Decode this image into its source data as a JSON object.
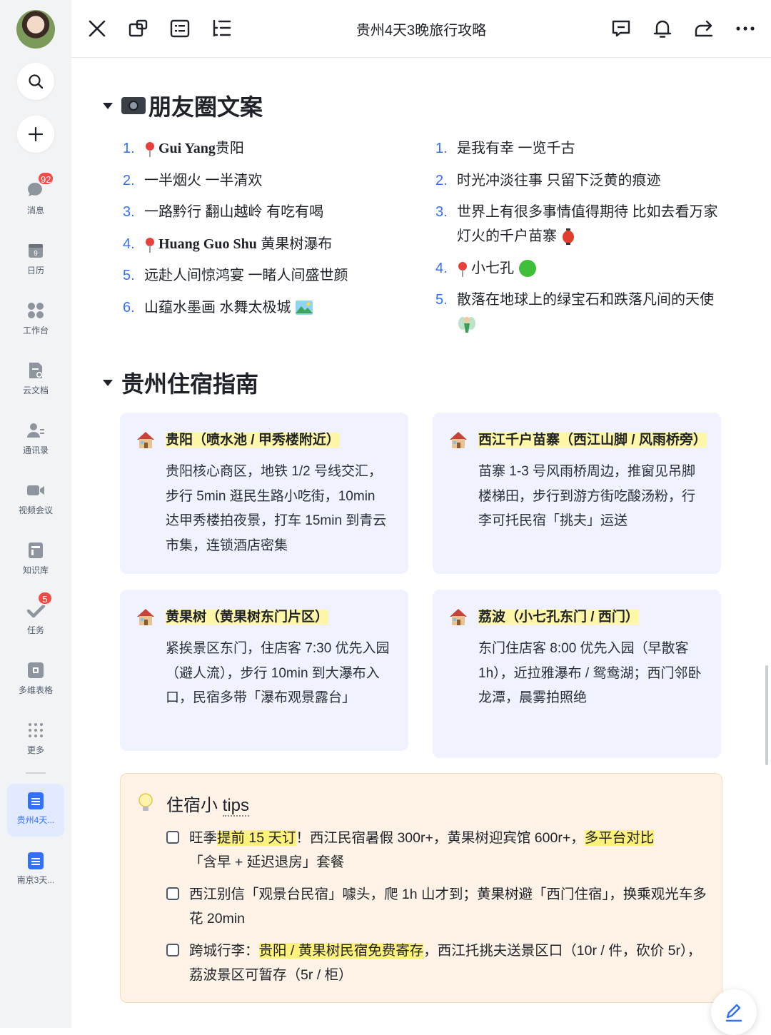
{
  "sidebar": {
    "nav": [
      {
        "label": "消息",
        "icon": "chat-bubble-icon",
        "badge": "92"
      },
      {
        "label": "日历",
        "icon": "calendar-icon",
        "date": "9"
      },
      {
        "label": "工作台",
        "icon": "apps-grid-icon"
      },
      {
        "label": "云文档",
        "icon": "cloud-doc-icon"
      },
      {
        "label": "通讯录",
        "icon": "contacts-icon"
      },
      {
        "label": "视频会议",
        "icon": "video-camera-icon"
      },
      {
        "label": "知识库",
        "icon": "knowledge-base-icon"
      },
      {
        "label": "任务",
        "icon": "task-check-icon",
        "badge": "5"
      },
      {
        "label": "多维表格",
        "icon": "base-table-icon"
      },
      {
        "label": "更多",
        "icon": "more-dots-grid-icon"
      }
    ],
    "open_docs": [
      {
        "label": "贵州4天...",
        "active": true
      },
      {
        "label": "南京3天...",
        "active": false
      }
    ]
  },
  "topbar": {
    "title": "贵州4天3晚旅行攻略"
  },
  "section1": {
    "heading": "朋友圈文案",
    "left_list": [
      {
        "num": "1.",
        "pin": true,
        "bold": "Gui Yang",
        "text": "贵阳"
      },
      {
        "num": "2.",
        "text": "一半烟火 一半清欢"
      },
      {
        "num": "3.",
        "text": "一路黔行 翻山越岭 有吃有喝"
      },
      {
        "num": "4.",
        "pin": true,
        "bold": "Huang Guo Shu",
        "text": " 黄果树瀑布"
      },
      {
        "num": "5.",
        "text": "远赴人间惊鸿宴 一睹人间盛世颜"
      },
      {
        "num": "6.",
        "text": "山蕴水墨画 水舞太极城"
      }
    ],
    "right_list": [
      {
        "num": "1.",
        "text": "是我有幸  一览千古"
      },
      {
        "num": "2.",
        "text": "时光冲淡往事  只留下泛黄的痕迹"
      },
      {
        "num": "3.",
        "text": "世界上有很多事情值得期待 比如去看万家灯火的千户苗寨"
      },
      {
        "num": "4.",
        "pin": true,
        "text": "小七孔"
      },
      {
        "num": "5.",
        "text": "散落在地球上的绿宝石和跌落凡间的天使"
      }
    ]
  },
  "section2": {
    "heading": "贵州住宿指南",
    "cards": [
      {
        "title": "贵阳（喷水池 / 甲秀楼附近）",
        "body": "贵阳核心商区，地铁 1/2 号线交汇，步行 5min 逛民生路小吃街，10min 达甲秀楼拍夜景，打车 15min 到青云市集，连锁酒店密集"
      },
      {
        "title": "西江千户苗寨（西江山脚 / 风雨桥旁）",
        "body": "苗寨 1-3 号风雨桥周边，推窗见吊脚楼梯田，步行到游方街吃酸汤粉，行李可托民宿「挑夫」运送"
      },
      {
        "title": "黄果树（黄果树东门片区）",
        "body": "紧挨景区东门，住店客 7:30 优先入园（避人流），步行 10min 到大瀑布入口，民宿多带「瀑布观景露台」"
      },
      {
        "title": "荔波（小七孔东门 / 西门）",
        "body": "东门住店客 8:00 优先入园（早散客 1h），近拉雅瀑布 / 鸳鸯湖；西门邻卧龙潭，晨雾拍照绝"
      }
    ]
  },
  "tips": {
    "title_a": "住宿小 ",
    "title_b": "tips",
    "items": [
      {
        "a": "旺季",
        "h1": "提前 15 天订",
        "b": "！西江民宿暑假 300r+，黄果树迎宾馆 600r+，",
        "h2": "多平台对比",
        "c": "「含早 + 延迟退房」套餐"
      },
      {
        "a": "西江别信「观景台民宿」噱头，爬 1h 山才到；黄果树避「西门住宿」，换乘观光车多花 20min"
      },
      {
        "a": "跨城行李：",
        "h1": "贵阳 / 黄果树民宿免费寄存",
        "b": "，西江托挑夫送景区口（10r / 件，砍价 5r），荔波景区可暂存（5r / 柜）"
      }
    ]
  },
  "colors": {
    "accent": "#3370ff",
    "card_bg": "#f0f3ff",
    "tips_bg": "#fef3e6",
    "highlight": "#fff27a",
    "badge": "#f54a45"
  }
}
